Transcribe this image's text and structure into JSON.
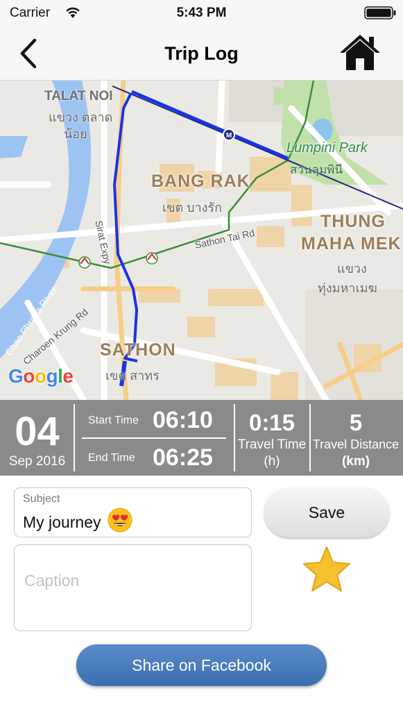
{
  "status_bar": {
    "carrier": "Carrier",
    "time": "5:43 PM"
  },
  "nav": {
    "title": "Trip Log"
  },
  "map": {
    "areas": [
      {
        "name": "TALAT NOI",
        "thai_line1": "แขวง ตลาด",
        "thai_line2": "น้อย"
      },
      {
        "name": "BANG RAK",
        "thai": "เขต บางรัก"
      },
      {
        "name": "THUNG",
        "name_line2": "MAHA MEK",
        "thai_line1": "แขวง",
        "thai_line2": "ทุ่งมหาเมฆ"
      },
      {
        "name": "SATHON",
        "thai": "เขต สาทร"
      }
    ],
    "park": {
      "name": "Lumpini Park",
      "thai": "สวนลุมพินี"
    },
    "roads": {
      "sirat": "Sirat Expy",
      "sathon_tai": "Sathon Tai Rd",
      "charoen_krung": "Charoen Krung Rd",
      "river": "Chao Phraya River"
    },
    "attribution": "Google",
    "route_color": "#1a33e6"
  },
  "trip": {
    "day": "04",
    "month_year": "Sep 2016",
    "start_label": "Start Time",
    "start_time": "06:10",
    "end_label": "End Time",
    "end_time": "06:25",
    "travel_time": {
      "value": "0:15",
      "label": "Travel Time",
      "unit": "(h)"
    },
    "travel_distance": {
      "value": "5",
      "label": "Travel Distance",
      "unit": "(km)"
    }
  },
  "form": {
    "subject_label": "Subject",
    "subject_value": "My journey",
    "subject_emoji": "heart-eyes-emoji",
    "caption_placeholder": "Caption",
    "save_label": "Save",
    "favorite_icon": "star-icon",
    "share_label": "Share on Facebook"
  },
  "colors": {
    "stats_bg": "#8a8a8a",
    "share_button": "#4a7dbf",
    "star": "#f5c12e"
  }
}
